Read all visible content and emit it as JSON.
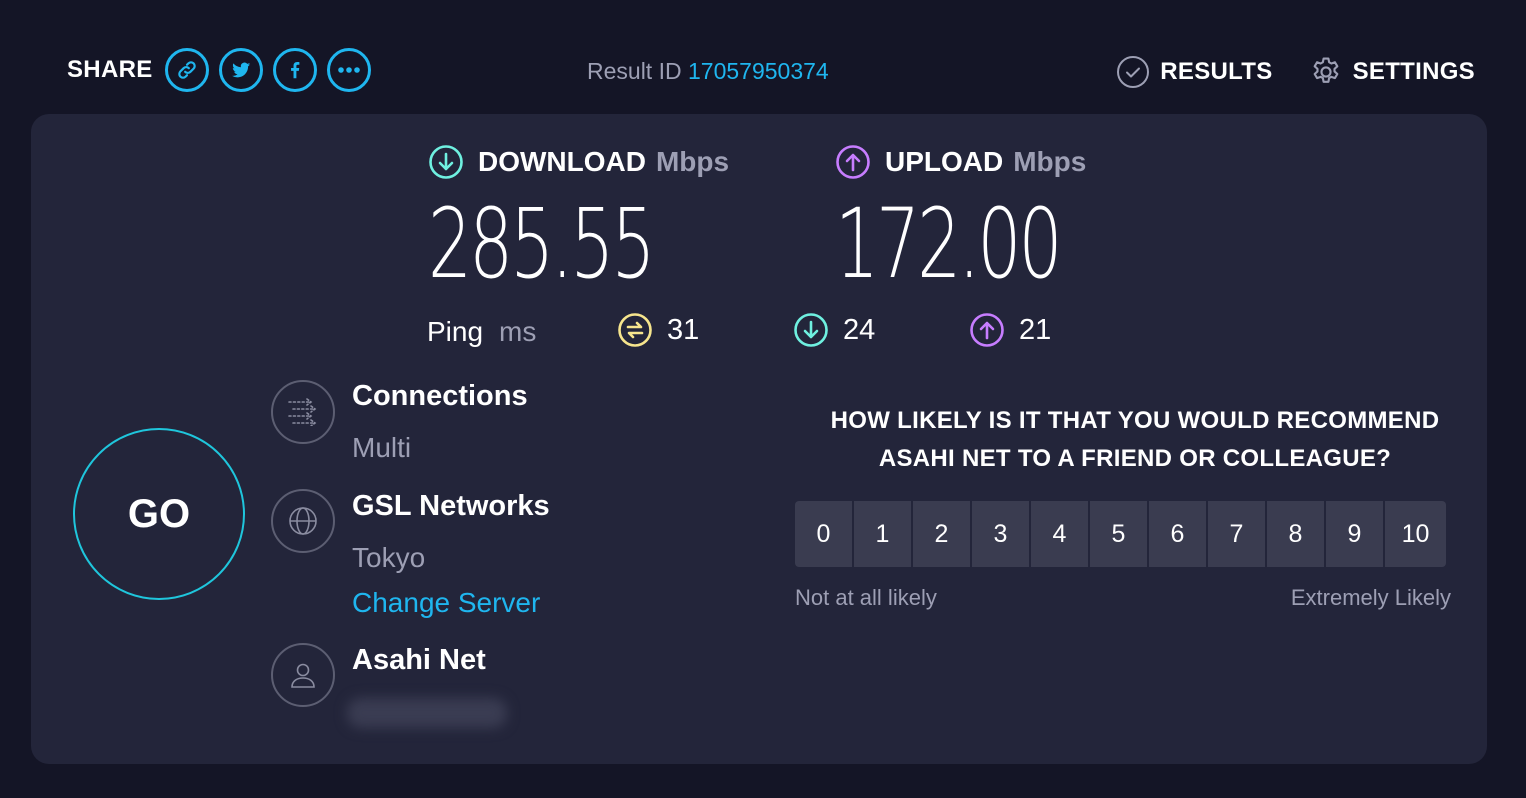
{
  "share": {
    "label": "SHARE",
    "buttons": [
      {
        "icon": "link-icon"
      },
      {
        "icon": "twitter-icon"
      },
      {
        "icon": "facebook-icon"
      },
      {
        "icon": "more-icon"
      }
    ]
  },
  "result": {
    "label": "Result ID",
    "id": "17057950374"
  },
  "nav": {
    "results": "RESULTS",
    "settings": "SETTINGS"
  },
  "download": {
    "label": "DOWNLOAD",
    "unit": "Mbps",
    "value": "285.55",
    "color": "#6ff0e0"
  },
  "upload": {
    "label": "UPLOAD",
    "unit": "Mbps",
    "value": "172.00",
    "color": "#c77dff"
  },
  "ping": {
    "label": "Ping",
    "unit": "ms",
    "idle": "31",
    "download": "24",
    "upload": "21",
    "idle_color": "#f6e58d"
  },
  "go": {
    "label": "GO"
  },
  "connections": {
    "title": "Connections",
    "value": "Multi"
  },
  "server": {
    "title": "GSL Networks",
    "location": "Tokyo",
    "change": "Change Server"
  },
  "isp": {
    "title": "Asahi Net"
  },
  "survey": {
    "question_line1": "HOW LIKELY IS IT THAT YOU WOULD RECOMMEND",
    "question_line2": "ASAHI NET TO A FRIEND OR COLLEAGUE?",
    "options": [
      "0",
      "1",
      "2",
      "3",
      "4",
      "5",
      "6",
      "7",
      "8",
      "9",
      "10"
    ],
    "low_label": "Not at all likely",
    "high_label": "Extremely Likely"
  }
}
